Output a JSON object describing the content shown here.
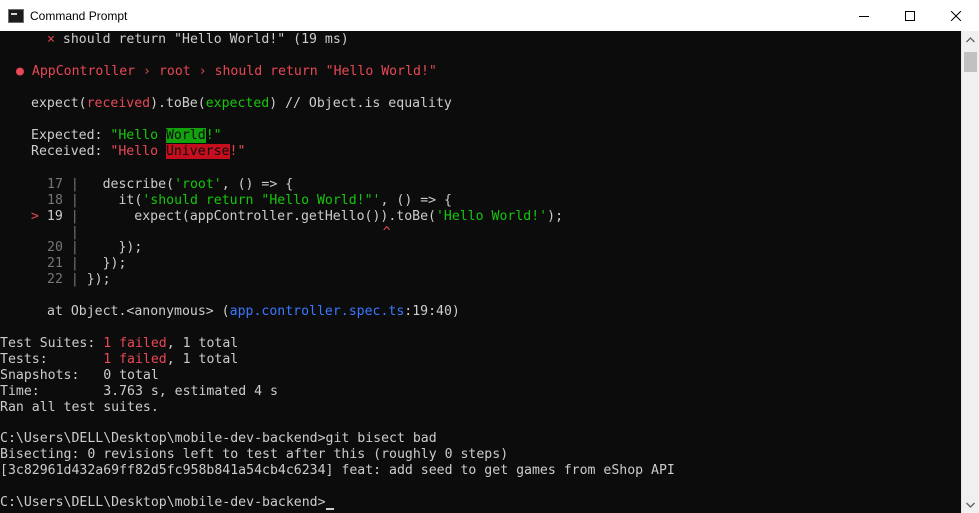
{
  "window": {
    "title": "Command Prompt",
    "controls": {
      "minimize": "minimize",
      "maximize": "maximize",
      "close": "close"
    }
  },
  "console": {
    "failed_test_line": {
      "mark": "×",
      "text": "should return \"Hello World!\" (19 ms)"
    },
    "error_header": {
      "bullet": "●",
      "text": "AppController › root › should return \"Hello World!\""
    },
    "expect_line": {
      "prefix": "expect(",
      "received": "received",
      "middle": ").toBe(",
      "expected": "expected",
      "suffix": ") // Object.is equality"
    },
    "expected_line": {
      "label": "Expected: ",
      "pre": "\"Hello ",
      "diff": "World",
      "post": "!\""
    },
    "received_line": {
      "label": "Received: ",
      "pre": "\"Hello ",
      "diff": "Universe",
      "post": "!\""
    },
    "code_frame": {
      "l17": {
        "num": "17",
        "code_a": "describe(",
        "str": "'root'",
        "code_b": ", () => {"
      },
      "l18": {
        "num": "18",
        "code_a": "it(",
        "str": "'should return \"Hello World!\"'",
        "code_b": ", () => {"
      },
      "l19": {
        "marker": ">",
        "num": "19",
        "code_a": "expect(appController.getHello()).toBe(",
        "str": "'Hello World!'",
        "code_b": ");"
      },
      "caret": "^",
      "l20": {
        "num": "20",
        "code": "});"
      },
      "l21": {
        "num": "21",
        "code": "});"
      },
      "l22": {
        "num": "22",
        "code": "});"
      }
    },
    "stack_line": {
      "pre": "at Object.<anonymous> (",
      "file": "app.controller.spec.ts",
      "loc": ":19:40)"
    },
    "summary": {
      "suites": {
        "label": "Test Suites: ",
        "failed": "1 failed",
        "rest": ", 1 total"
      },
      "tests": {
        "label": "Tests:       ",
        "failed": "1 failed",
        "rest": ", 1 total"
      },
      "snapshots": {
        "label": "Snapshots:   ",
        "value": "0 total"
      },
      "time": {
        "label": "Time:        ",
        "value": "3.763 s, estimated 4 s"
      },
      "ran": "Ran all test suites."
    },
    "bisect": {
      "prompt_cmd": "C:\\Users\\DELL\\Desktop\\mobile-dev-backend>git bisect bad",
      "status": "Bisecting: 0 revisions left to test after this (roughly 0 steps)",
      "commit": "[3c82961d432a69ff82d5fc958b841a54cb4c6234] feat: add seed to get games from eShop API"
    },
    "final_prompt": "C:\\Users\\DELL\\Desktop\\mobile-dev-backend>"
  },
  "colors": {
    "background": "#0c0c0c",
    "text": "#cccccc",
    "red": "#e74856",
    "green": "#16c60c",
    "blue": "#3b78ff",
    "gray": "#767676"
  }
}
